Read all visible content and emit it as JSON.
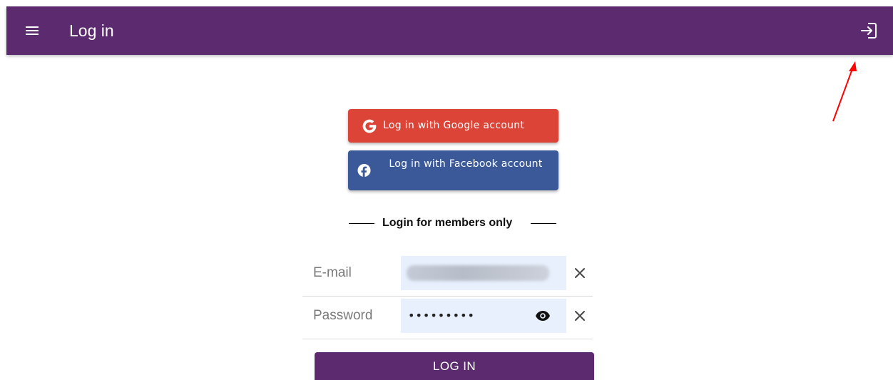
{
  "appbar": {
    "title": "Log in",
    "menu_icon": "menu-icon",
    "action_icon": "login-icon",
    "background": "#5c2a6e"
  },
  "social": {
    "google": {
      "label": "Log in with Google account",
      "icon": "google-icon",
      "color": "#db4437"
    },
    "facebook": {
      "label": "Log in with Facebook account",
      "icon": "facebook-icon",
      "color": "#3b5998"
    }
  },
  "separator": {
    "label": "Login for members only"
  },
  "form": {
    "email": {
      "label": "E-mail",
      "value": ""
    },
    "password": {
      "label": "Password",
      "value": "•••••••••",
      "reveal_icon": "eye-icon"
    },
    "clear_icon": "close-icon",
    "submit_label": "LOG IN",
    "field_background": "#e8f0fe"
  },
  "annotation": {
    "color": "#ff0000",
    "points_to": "login-icon"
  }
}
